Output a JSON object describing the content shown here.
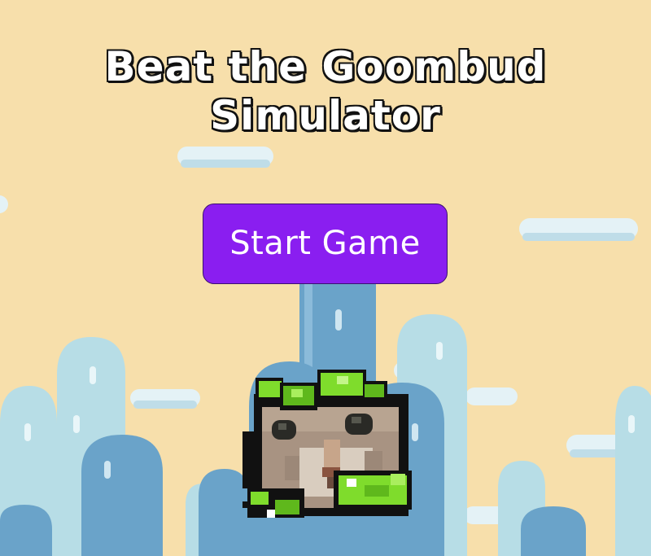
{
  "game": {
    "title_line1": "Beat the Goombud",
    "title_line2": "Simulator",
    "start_button_label": "Start Game"
  },
  "colors": {
    "background": "#f7dfab",
    "button": "#8a1ef0",
    "pillar_dark": "#6aa3c9",
    "pillar_light": "#b7dde6",
    "cloud": "#e4f2f6",
    "leaf_green": "#7fdc2c"
  },
  "icons": {
    "player": "cat-face-with-leaves-sprite",
    "clouds": "cloud-icon",
    "pillars": "pipe-pillar-icon"
  }
}
